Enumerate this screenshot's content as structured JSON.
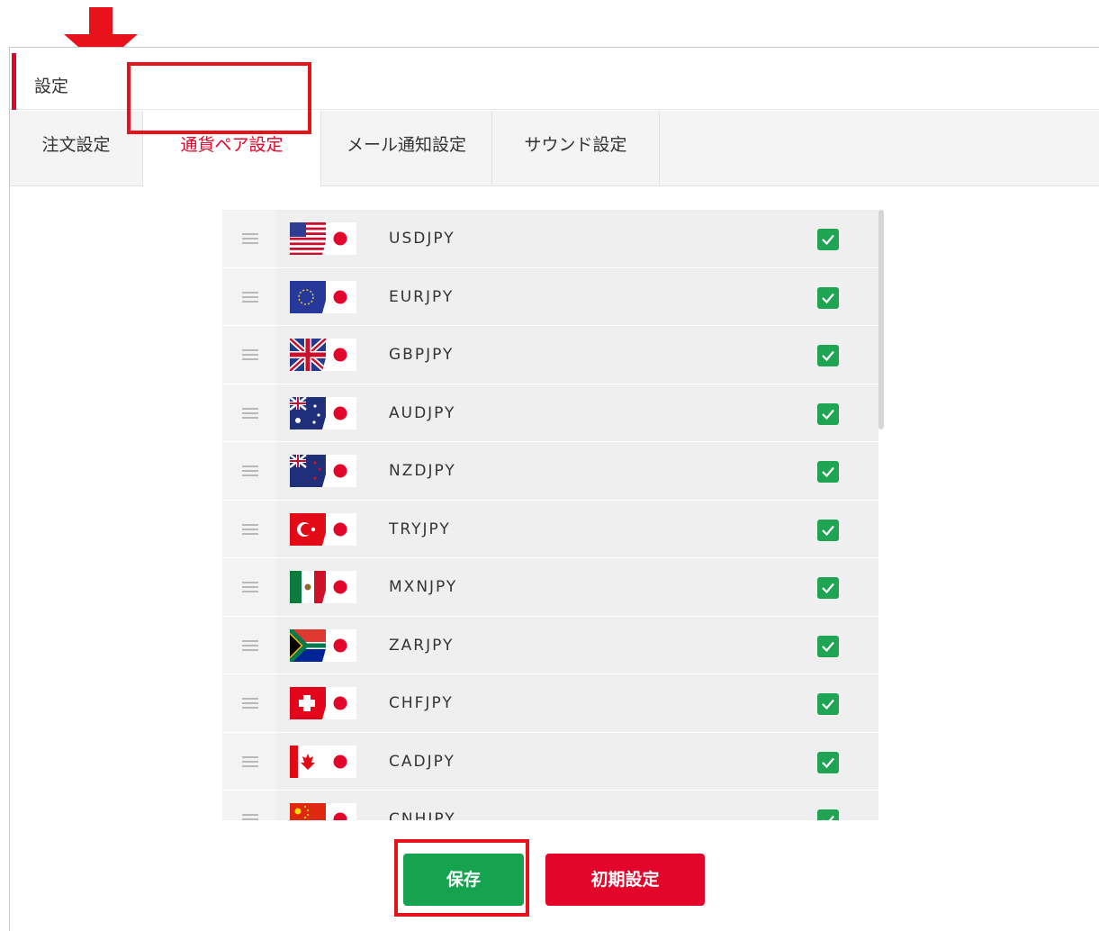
{
  "panel": {
    "title": "設定",
    "accent_color": "#e4052a"
  },
  "tabs": [
    {
      "label": "注文設定",
      "active": false
    },
    {
      "label": "通貨ペア設定",
      "active": true
    },
    {
      "label": "メール通知設定",
      "active": false
    },
    {
      "label": "サウンド設定",
      "active": false
    }
  ],
  "colors": {
    "active_tab_text": "#e4052a",
    "annotation": "#e8121a",
    "check": "#1fa453",
    "save": "#16a350",
    "reset": "#e4052a"
  },
  "pairs": [
    {
      "code": "USDJPY",
      "flag_icon": "us-flag-icon",
      "checked": true
    },
    {
      "code": "EURJPY",
      "flag_icon": "eu-flag-icon",
      "checked": true
    },
    {
      "code": "GBPJPY",
      "flag_icon": "gb-flag-icon",
      "checked": true
    },
    {
      "code": "AUDJPY",
      "flag_icon": "au-flag-icon",
      "checked": true
    },
    {
      "code": "NZDJPY",
      "flag_icon": "nz-flag-icon",
      "checked": true
    },
    {
      "code": "TRYJPY",
      "flag_icon": "tr-flag-icon",
      "checked": true
    },
    {
      "code": "MXNJPY",
      "flag_icon": "mx-flag-icon",
      "checked": true
    },
    {
      "code": "ZARJPY",
      "flag_icon": "za-flag-icon",
      "checked": true
    },
    {
      "code": "CHFJPY",
      "flag_icon": "ch-flag-icon",
      "checked": true
    },
    {
      "code": "CADJPY",
      "flag_icon": "ca-flag-icon",
      "checked": true
    },
    {
      "code": "CNHJPY",
      "flag_icon": "cn-flag-icon",
      "checked": true
    }
  ],
  "buttons": {
    "save_label": "保存",
    "reset_label": "初期設定"
  }
}
